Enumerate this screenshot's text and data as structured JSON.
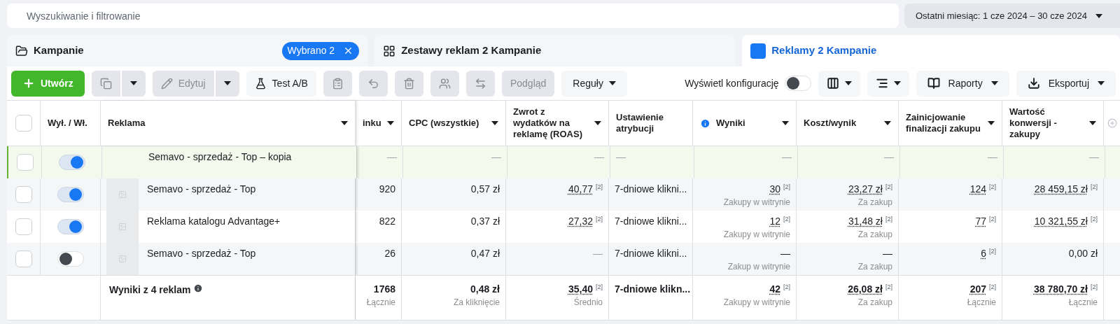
{
  "search": {
    "placeholder": "Wyszukiwanie i filtrowanie"
  },
  "date_range": {
    "label": "Ostatni miesiąc: 1 cze 2024 – 30 cze 2024"
  },
  "tabs": [
    {
      "label": "Kampanie",
      "badge": "Wybrano 2",
      "selected": false
    },
    {
      "label": "Zestawy reklam 2 Kampanie",
      "selected": false
    },
    {
      "label": "Reklamy 2 Kampanie",
      "selected": true
    }
  ],
  "toolbar": [
    {
      "kind": "primary",
      "label": "Utwórz",
      "disabled": false
    },
    {
      "kind": "icon",
      "disabled": true,
      "caret": true
    },
    {
      "kind": "text",
      "label": "Edytuj",
      "disabled": true,
      "caret": true
    },
    {
      "kind": "text",
      "label": "Test A/B",
      "disabled": false
    },
    {
      "kind": "icon",
      "disabled": true
    },
    {
      "kind": "icon",
      "disabled": true
    },
    {
      "kind": "icon",
      "disabled": true
    },
    {
      "kind": "icon",
      "disabled": true
    },
    {
      "kind": "icon",
      "disabled": true
    },
    {
      "kind": "text",
      "label": "Podgląd",
      "disabled": true
    },
    {
      "kind": "menu",
      "label": "Reguły",
      "disabled": false
    }
  ],
  "display_config": {
    "label": "Wyświetl konfigurację",
    "on": false
  },
  "toolbar_right": [
    {
      "kind": "icon"
    },
    {
      "kind": "icon"
    },
    {
      "kind": "menu",
      "label": "Raporty"
    },
    {
      "kind": "menu",
      "label": "Eksportuj"
    }
  ],
  "table": {
    "all_checked": false,
    "fixed_columns": [
      {
        "label": "Wył. / Wł.",
        "caret": false
      },
      {
        "label": "Reklama",
        "caret": true
      }
    ],
    "columns": [
      {
        "label": "inku",
        "kind": "number",
        "caret": true,
        "info": false
      },
      {
        "label": "CPC (wszystkie)",
        "kind": "number",
        "caret": true,
        "info": false
      },
      {
        "label": "Zwrot z wydatków na reklamę (ROAS)",
        "kind": "number",
        "caret": true,
        "info": false
      },
      {
        "label": "Ustawienie atrybucji",
        "kind": "text",
        "caret": false,
        "info": false
      },
      {
        "label": "Wyniki",
        "kind": "number",
        "caret": true,
        "info": true
      },
      {
        "label": "Koszt/wynik",
        "kind": "number",
        "caret": true,
        "info": false
      },
      {
        "label": "Zainicjowanie finalizacji zakupu",
        "kind": "number",
        "caret": true,
        "info": false
      },
      {
        "label": "Wartość konwersji - zakupy",
        "kind": "number",
        "caret": true,
        "info": false
      }
    ],
    "rows": [
      {
        "checked": false,
        "on": true,
        "highlighted": true,
        "thumbnail": false,
        "name": "Semavo - sprzedaż - Top – kopia",
        "cells": [
          {
            "value": "—"
          },
          {
            "value": "—"
          },
          {
            "value": "—"
          },
          {
            "value": "—"
          },
          {
            "value": "—"
          },
          {
            "value": "—"
          },
          {
            "value": "—"
          },
          {
            "value": "—"
          }
        ]
      },
      {
        "checked": false,
        "on": true,
        "highlighted": false,
        "thumbnail": true,
        "name": "Semavo - sprzedaż - Top",
        "cells": [
          {
            "value": "920"
          },
          {
            "value": "0,57 zł"
          },
          {
            "value": "40,77",
            "note": "[2]"
          },
          {
            "value": "7-dniowe klikni..."
          },
          {
            "value": "30",
            "note": "[2]",
            "sub": "Zakupy w witrynie"
          },
          {
            "value": "23,27 zł",
            "note": "[2]",
            "sub": "Za zakup"
          },
          {
            "value": "124",
            "note": "[2]"
          },
          {
            "value": "28 459,15 zł",
            "note": "[2]"
          }
        ]
      },
      {
        "checked": false,
        "on": true,
        "highlighted": false,
        "thumbnail": true,
        "name": "Reklama katalogu Advantage+",
        "cells": [
          {
            "value": "822"
          },
          {
            "value": "0,37 zł"
          },
          {
            "value": "27,32",
            "note": "[2]"
          },
          {
            "value": "7-dniowe klikni..."
          },
          {
            "value": "12",
            "note": "[2]",
            "sub": "Zakupy w witrynie"
          },
          {
            "value": "31,48 zł",
            "note": "[2]",
            "sub": "Za zakup"
          },
          {
            "value": "77",
            "note": "[2]"
          },
          {
            "value": "10 321,55 zł",
            "note": "[2]"
          }
        ]
      },
      {
        "checked": false,
        "on": false,
        "highlighted": false,
        "thumbnail": true,
        "name": "Semavo - sprzedaż - Top",
        "cells": [
          {
            "value": "26"
          },
          {
            "value": "0,47 zł"
          },
          {
            "value": "—"
          },
          {
            "value": "7-dniowe klikni..."
          },
          {
            "value": "—",
            "sub": "Zakup w witrynie"
          },
          {
            "value": "—",
            "sub": "Za zakup"
          },
          {
            "value": "6",
            "note": "[2]"
          },
          {
            "value": "0,00 zł"
          }
        ]
      }
    ],
    "footer": {
      "label": "Wyniki z 4 reklam",
      "cells": [
        {
          "value": "1768",
          "sub": "Łącznie"
        },
        {
          "value": "0,48 zł",
          "sub": "Za kliknięcie"
        },
        {
          "value": "35,40",
          "note": "[2]",
          "sub": "Średnio"
        },
        {
          "value": "7-dniowe klikn..."
        },
        {
          "value": "42",
          "note": "[2]",
          "sub": "Zakupy w witrynie"
        },
        {
          "value": "26,08 zł",
          "note": "[2]",
          "sub": "Za zakup"
        },
        {
          "value": "207",
          "note": "[2]",
          "sub": "Łącznie"
        },
        {
          "value": "38 780,70 zł",
          "note": "[2]",
          "sub": "Łącznie"
        }
      ]
    }
  }
}
